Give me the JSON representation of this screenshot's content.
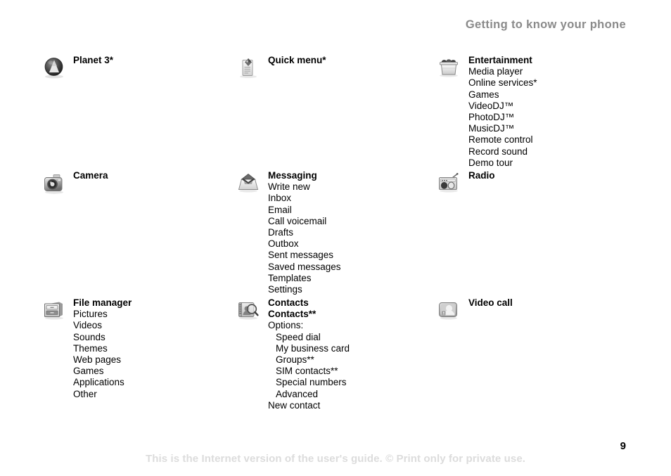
{
  "header": {
    "title": "Getting to know your phone"
  },
  "columns": [
    {
      "name": "column-left",
      "groups": [
        {
          "icon": "planet-icon",
          "title": "Planet 3*",
          "items": []
        },
        {
          "icon": "camera-icon",
          "title": "Camera",
          "items": []
        },
        {
          "icon": "file-manager-icon",
          "title": "File manager",
          "items": [
            {
              "label": "Pictures",
              "indent": false,
              "bold": false
            },
            {
              "label": "Videos",
              "indent": false,
              "bold": false
            },
            {
              "label": "Sounds",
              "indent": false,
              "bold": false
            },
            {
              "label": "Themes",
              "indent": false,
              "bold": false
            },
            {
              "label": "Web pages",
              "indent": false,
              "bold": false
            },
            {
              "label": "Games",
              "indent": false,
              "bold": false
            },
            {
              "label": "Applications",
              "indent": false,
              "bold": false
            },
            {
              "label": "Other",
              "indent": false,
              "bold": false
            }
          ]
        }
      ]
    },
    {
      "name": "column-middle",
      "groups": [
        {
          "icon": "quick-menu-icon",
          "title": "Quick menu*",
          "items": []
        },
        {
          "icon": "messaging-icon",
          "title": "Messaging",
          "items": [
            {
              "label": "Write new",
              "indent": false,
              "bold": false
            },
            {
              "label": "Inbox",
              "indent": false,
              "bold": false
            },
            {
              "label": "Email",
              "indent": false,
              "bold": false
            },
            {
              "label": "Call voicemail",
              "indent": false,
              "bold": false
            },
            {
              "label": "Drafts",
              "indent": false,
              "bold": false
            },
            {
              "label": "Outbox",
              "indent": false,
              "bold": false
            },
            {
              "label": "Sent messages",
              "indent": false,
              "bold": false
            },
            {
              "label": "Saved messages",
              "indent": false,
              "bold": false
            },
            {
              "label": "Templates",
              "indent": false,
              "bold": false
            },
            {
              "label": "Settings",
              "indent": false,
              "bold": false
            }
          ]
        },
        {
          "icon": "contacts-icon",
          "title": "Contacts",
          "items": [
            {
              "label": "Contacts**",
              "indent": false,
              "bold": true
            },
            {
              "label": "Options:",
              "indent": false,
              "bold": false
            },
            {
              "label": "Speed dial",
              "indent": true,
              "bold": false
            },
            {
              "label": "My business card",
              "indent": true,
              "bold": false
            },
            {
              "label": "Groups**",
              "indent": true,
              "bold": false
            },
            {
              "label": "SIM contacts**",
              "indent": true,
              "bold": false
            },
            {
              "label": "Special numbers",
              "indent": true,
              "bold": false
            },
            {
              "label": "Advanced",
              "indent": true,
              "bold": false
            },
            {
              "label": "New contact",
              "indent": false,
              "bold": false
            }
          ]
        }
      ]
    },
    {
      "name": "column-right",
      "groups": [
        {
          "icon": "entertainment-icon",
          "title": "Entertainment",
          "items": [
            {
              "label": "Media player",
              "indent": false,
              "bold": false
            },
            {
              "label": "Online services*",
              "indent": false,
              "bold": false
            },
            {
              "label": "Games",
              "indent": false,
              "bold": false
            },
            {
              "label": "VideoDJ™",
              "indent": false,
              "bold": false
            },
            {
              "label": "PhotoDJ™",
              "indent": false,
              "bold": false
            },
            {
              "label": "MusicDJ™",
              "indent": false,
              "bold": false
            },
            {
              "label": "Remote control",
              "indent": false,
              "bold": false
            },
            {
              "label": "Record sound",
              "indent": false,
              "bold": false
            },
            {
              "label": "Demo tour",
              "indent": false,
              "bold": false
            }
          ]
        },
        {
          "icon": "radio-icon",
          "title": "Radio",
          "items": []
        },
        {
          "icon": "video-call-icon",
          "title": "Video call",
          "items": []
        }
      ]
    }
  ],
  "footer": {
    "note": "This is the Internet version of the user's guide. © Print only for private use.",
    "page_number": "9"
  },
  "colors": {
    "header_gray": "#8a8a8a",
    "footer_gray": "#dcdcdc",
    "text_black": "#000000",
    "background": "#ffffff"
  }
}
